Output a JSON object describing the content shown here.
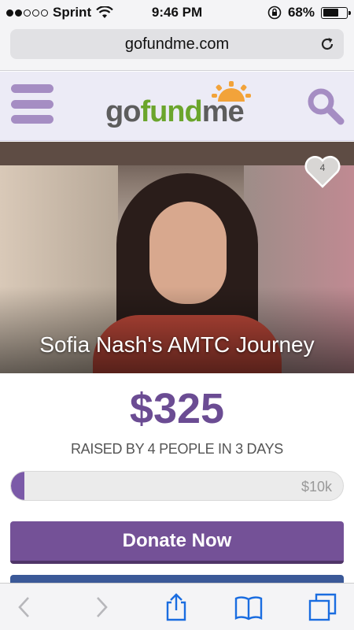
{
  "status_bar": {
    "carrier": "Sprint",
    "time": "9:46 PM",
    "battery_percent": "68%",
    "battery_level": 0.68,
    "icons": [
      "signal-dots",
      "wifi-icon",
      "rotation-lock-icon",
      "battery-icon"
    ]
  },
  "browser": {
    "url": "gofundme.com",
    "reload_icon": "reload-icon"
  },
  "site": {
    "logo": {
      "go": "go",
      "fund": "fund",
      "me": "me"
    },
    "menu_icon": "hamburger-icon",
    "search_icon": "search-icon",
    "colors": {
      "brand_purple": "#745197",
      "logo_green": "#6ba52c",
      "logo_sun": "#f2a33a"
    }
  },
  "campaign": {
    "title": "Sofia Nash's AMTC Journey",
    "likes": "4",
    "raised": "$325",
    "raised_sub": "RAISED BY 4 PEOPLE IN 3 DAYS",
    "goal": "$10k",
    "progress_fraction": 0.0325
  },
  "actions": {
    "donate_label": "Donate Now"
  },
  "toolbar": {
    "items": [
      "back-icon",
      "forward-icon",
      "share-icon",
      "bookmarks-icon",
      "tabs-icon"
    ]
  }
}
